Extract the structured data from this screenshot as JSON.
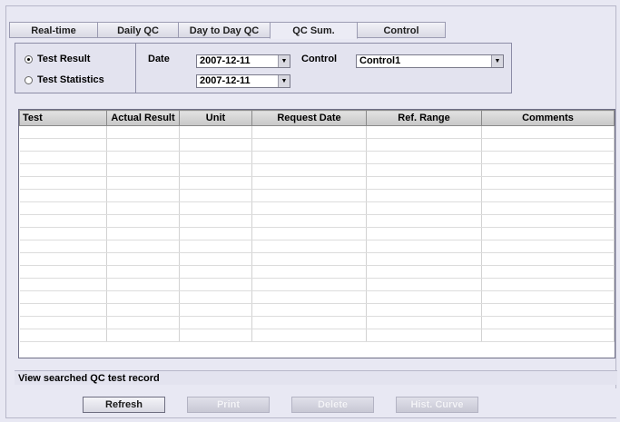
{
  "tabs": [
    {
      "label": "Real-time"
    },
    {
      "label": "Daily QC"
    },
    {
      "label": "Day to Day QC"
    },
    {
      "label": "QC Sum."
    },
    {
      "label": "Control"
    }
  ],
  "filters": {
    "mode_options": [
      {
        "label": "Test Result",
        "checked": true
      },
      {
        "label": "Test Statistics",
        "checked": false
      }
    ],
    "date_label": "Date",
    "date_from": "2007-12-11",
    "date_to": "2007-12-11",
    "control_label": "Control",
    "control_value": "Control1"
  },
  "table": {
    "columns": [
      "Test",
      "Actual Result",
      "Unit",
      "Request Date",
      "Ref. Range",
      "Comments"
    ],
    "empty_row_count": 17
  },
  "status_text": "View searched QC test record",
  "buttons": {
    "refresh": "Refresh",
    "print": "Print",
    "delete": "Delete",
    "hist_curve": "Hist. Curve"
  }
}
